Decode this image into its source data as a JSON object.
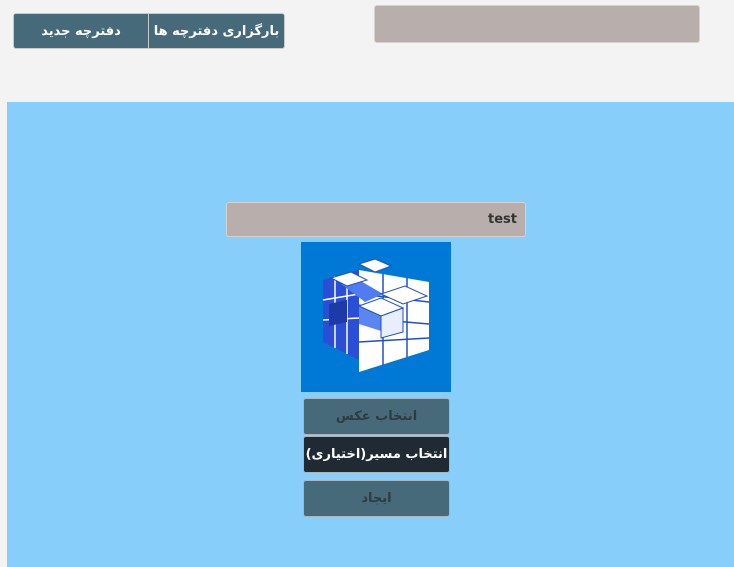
{
  "toolbar": {
    "new_notebook_label": "دفترچه جدید",
    "load_notebooks_label": "بارگزاری دفترچه ها",
    "search_value": ""
  },
  "form": {
    "name_value": "test",
    "choose_image_label": "انتخاب عکس",
    "choose_path_label": "انتخاب مسیر(اختیاری)",
    "create_label": "ایجاد"
  },
  "icons": {
    "preview_image": "cube-icon"
  },
  "colors": {
    "panel_background": "#87cefa",
    "button_background": "#476a7a",
    "button_dark": "#1f2a33",
    "input_background": "#b8aeac",
    "image_background": "#0079d6"
  }
}
